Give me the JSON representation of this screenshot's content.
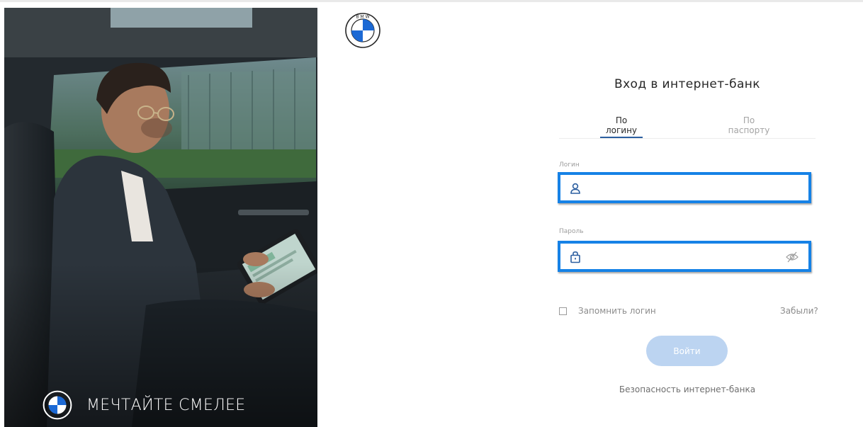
{
  "hero": {
    "slogan": "МЕЧТАЙТЕ СМЕЛЕЕ",
    "logo_icon": "bmw-logo-icon"
  },
  "header": {
    "logo_icon": "bmw-logo-icon"
  },
  "form": {
    "title": "Вход в интернет-банк",
    "tabs": [
      {
        "label": "По логину",
        "active": true
      },
      {
        "label": "По паспорту",
        "active": false
      }
    ],
    "login": {
      "label": "Логин",
      "value": "",
      "placeholder": "",
      "icon": "user-icon"
    },
    "password": {
      "label": "Пароль",
      "value": "",
      "placeholder": "",
      "icon": "lock-icon",
      "toggle_icon": "eye-hidden-icon"
    },
    "remember_label": "Запомнить логин",
    "remember_checked": false,
    "forgot_label": "Забыли?",
    "submit_label": "Войти",
    "security_link": "Безопасность интернет-банка"
  },
  "colors": {
    "accent": "#2c5fa0",
    "focus_border": "#1682e6",
    "submit_disabled": "#bcd4f1",
    "bmw_blue": "#1c69d4"
  }
}
